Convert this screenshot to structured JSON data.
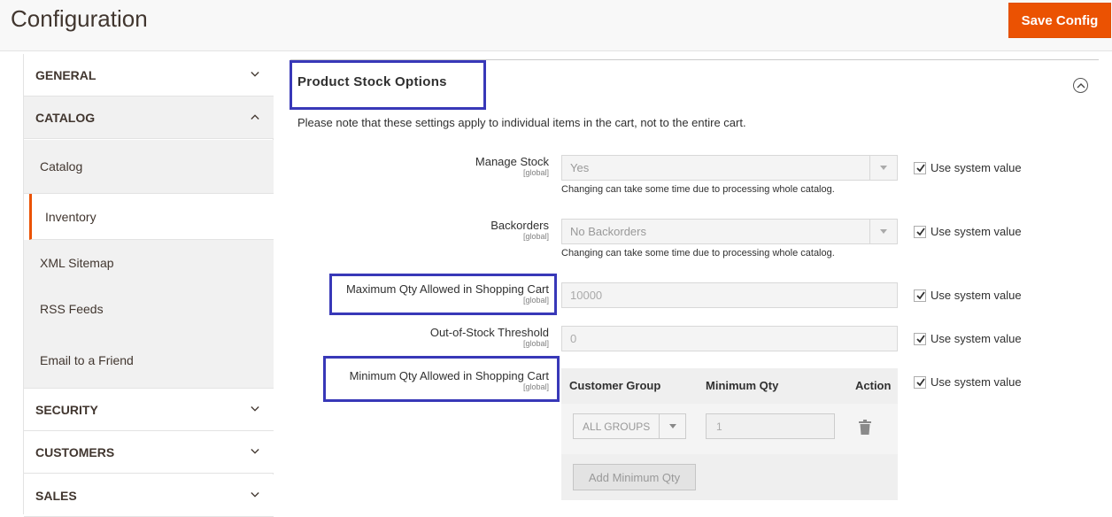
{
  "header": {
    "title": "Configuration",
    "save_label": "Save Config"
  },
  "sidebar": {
    "tabs": [
      {
        "label": "GENERAL",
        "expanded": false
      },
      {
        "label": "CATALOG",
        "expanded": true
      },
      {
        "label": "SECURITY",
        "expanded": false
      },
      {
        "label": "CUSTOMERS",
        "expanded": false
      },
      {
        "label": "SALES",
        "expanded": false
      }
    ],
    "catalog_items": [
      "Catalog",
      "Inventory",
      "XML Sitemap",
      "RSS Feeds",
      "Email to a Friend"
    ],
    "active_item": "Inventory"
  },
  "section": {
    "title": "Product Stock Options",
    "note": "Please note that these settings apply to individual items in the cart, not to the entire cart."
  },
  "fields": {
    "manage_stock": {
      "label": "Manage Stock",
      "scope": "[global]",
      "value": "Yes",
      "hint": "Changing can take some time due to processing whole catalog."
    },
    "backorders": {
      "label": "Backorders",
      "scope": "[global]",
      "value": "No Backorders",
      "hint": "Changing can take some time due to processing whole catalog."
    },
    "max_qty": {
      "label": "Maximum Qty Allowed in Shopping Cart",
      "scope": "[global]",
      "value": "10000"
    },
    "oos_threshold": {
      "label": "Out-of-Stock Threshold",
      "scope": "[global]",
      "value": "0"
    },
    "min_qty": {
      "label": "Minimum Qty Allowed in Shopping Cart",
      "scope": "[global]",
      "columns": [
        "Customer Group",
        "Minimum Qty",
        "Action"
      ],
      "row": {
        "group": "ALL GROUPS",
        "qty": "1"
      },
      "add_label": "Add Minimum Qty"
    },
    "use_system_value": "Use system value"
  },
  "colors": {
    "accent": "#eb5202",
    "highlight_box": "#3838b8"
  }
}
